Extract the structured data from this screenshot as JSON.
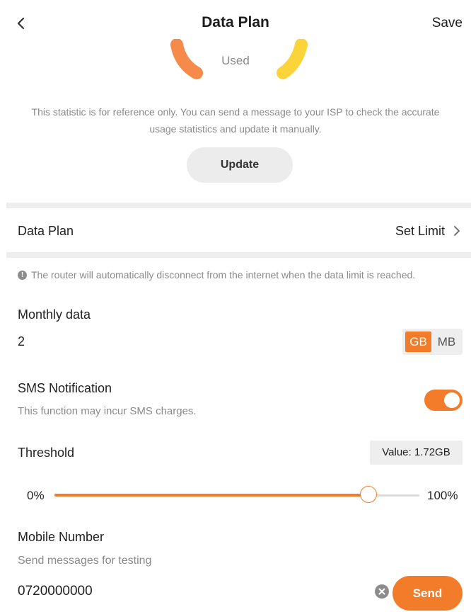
{
  "header": {
    "title": "Data Plan",
    "save_label": "Save"
  },
  "usage": {
    "gauge_label": "Used",
    "disclaimer": "This statistic is for reference only. You can send a message to your ISP to check the accurate usage statistics and update it manually.",
    "update_label": "Update"
  },
  "data_plan_row": {
    "label": "Data Plan",
    "value": "Set Limit"
  },
  "notice": "The router will automatically disconnect from the internet when the data limit is reached.",
  "monthly": {
    "label": "Monthly data",
    "value": "2",
    "units": [
      "GB",
      "MB"
    ],
    "selected_unit": "GB"
  },
  "sms": {
    "label": "SMS Notification",
    "sub": "This function may incur SMS charges.",
    "enabled": true
  },
  "threshold": {
    "label": "Threshold",
    "value_text": "Value: 1.72GB",
    "min_label": "0%",
    "max_label": "100%",
    "level_percent": 86
  },
  "mobile": {
    "label": "Mobile Number",
    "sub": "Send messages for testing",
    "value": "0720000000",
    "send_label": "Send"
  },
  "colors": {
    "accent": "#f37c2a",
    "gauge_left": "#f58a4a",
    "gauge_right": "#fbd43a",
    "muted_text": "#8a8a8a",
    "band": "#eeeeee"
  }
}
